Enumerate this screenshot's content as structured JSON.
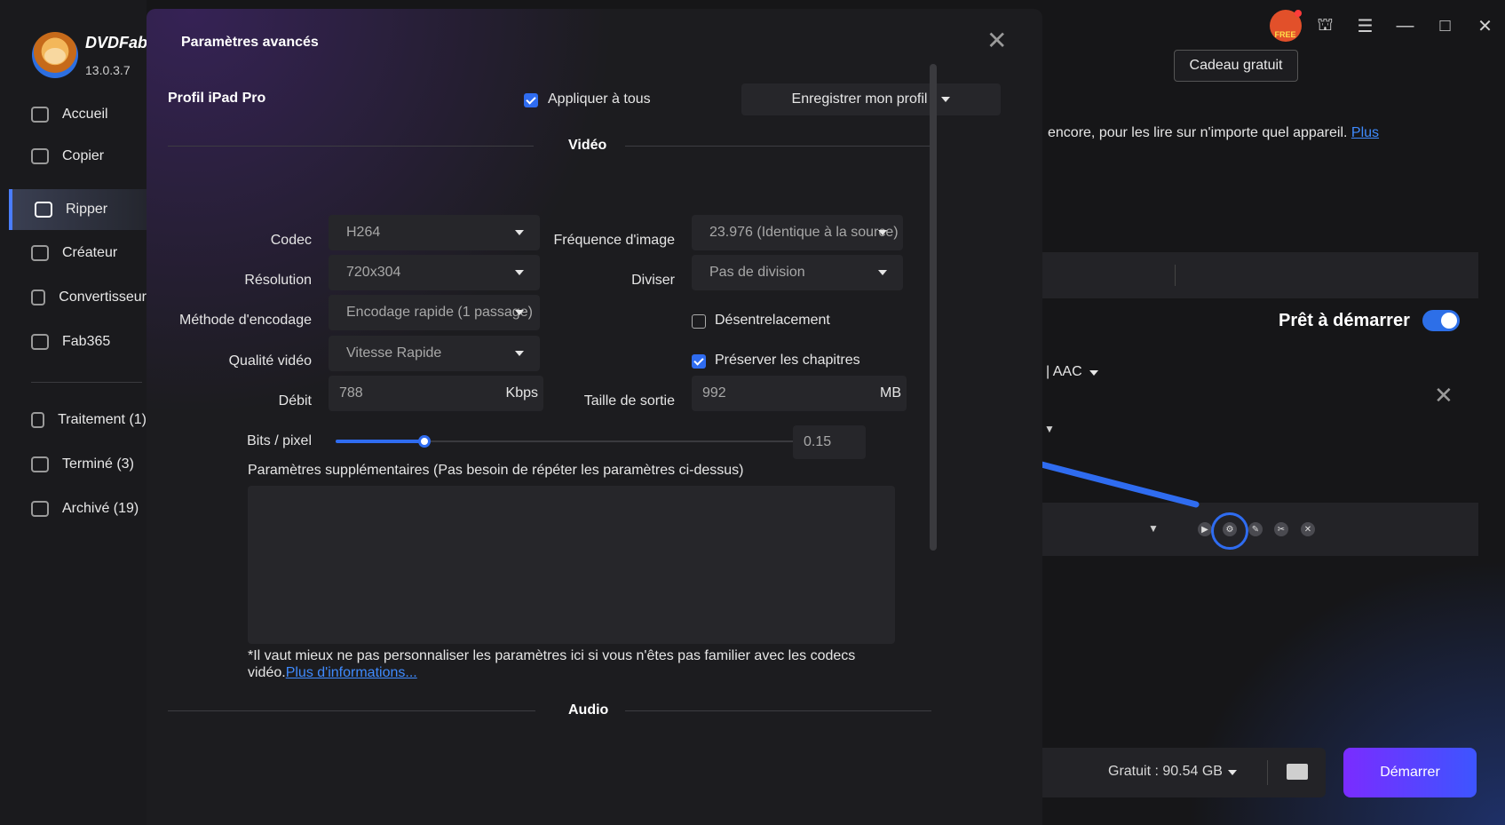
{
  "app": {
    "brand": "DVDFab",
    "version": "13.0.3.7"
  },
  "sidebar": {
    "items": [
      {
        "label": "Accueil",
        "icon": "home-icon"
      },
      {
        "label": "Copier",
        "icon": "copy-icon"
      },
      {
        "label": "Ripper",
        "icon": "ripper-icon",
        "active": true
      },
      {
        "label": "Créateur",
        "icon": "creator-icon"
      },
      {
        "label": "Convertisseur",
        "icon": "converter-icon"
      },
      {
        "label": "Fab365",
        "icon": "fab365-icon"
      }
    ],
    "queues": [
      {
        "label": "Traitement (1)",
        "icon": "processing-icon"
      },
      {
        "label": "Terminé (3)",
        "icon": "done-icon"
      },
      {
        "label": "Archivé (19)",
        "icon": "archive-icon"
      }
    ]
  },
  "topbar": {
    "free_badge": "FREE",
    "gift_button": "Cadeau gratuit"
  },
  "background": {
    "promo_text": "encore, pour les lire sur n'importe quel appareil. ",
    "promo_link": "Plus",
    "ready_label": "Prêt à démarrer",
    "ready_enabled": true,
    "audio_label": "| AAC",
    "free_space": "Gratuit : 90.54 GB",
    "start_button": "Démarrer"
  },
  "modal": {
    "title": "Paramètres avancés",
    "profile_label": "Profil iPad Pro",
    "apply_all_label": "Appliquer à tous",
    "apply_all_checked": true,
    "save_profile_label": "Enregistrer mon profil",
    "video_section": "Vidéo",
    "audio_section": "Audio",
    "fields": {
      "codec": {
        "label": "Codec",
        "value": "H264"
      },
      "framerate": {
        "label": "Fréquence d'image",
        "value": "23.976 (Identique à la source)"
      },
      "resolution": {
        "label": "Résolution",
        "value": "720x304"
      },
      "split": {
        "label": "Diviser",
        "value": "Pas de division"
      },
      "encoding": {
        "label": "Méthode d'encodage",
        "value": "Encodage rapide (1 passage)"
      },
      "deinterlace": {
        "label": "Désentrelacement",
        "checked": false
      },
      "quality": {
        "label": "Qualité vidéo",
        "value": "Vitesse Rapide"
      },
      "chapters": {
        "label": "Préserver les chapitres",
        "checked": true
      },
      "bitrate": {
        "label": "Débit",
        "value": "788",
        "unit": "Kbps"
      },
      "output_size": {
        "label": "Taille de sortie",
        "value": "992",
        "unit": "MB"
      },
      "bits_per_pixel": {
        "label": "Bits / pixel",
        "value": "0.15",
        "slider_fraction": 0.19
      }
    },
    "extra_params_label": "Paramètres supplémentaires (Pas besoin de répéter les paramètres ci-dessus)",
    "extra_params_value": "",
    "note_text": "*Il vaut mieux ne pas personnaliser les paramètres ici si vous n'êtes pas familier avec les codecs vidéo.",
    "note_link": "Plus d'informations..."
  }
}
